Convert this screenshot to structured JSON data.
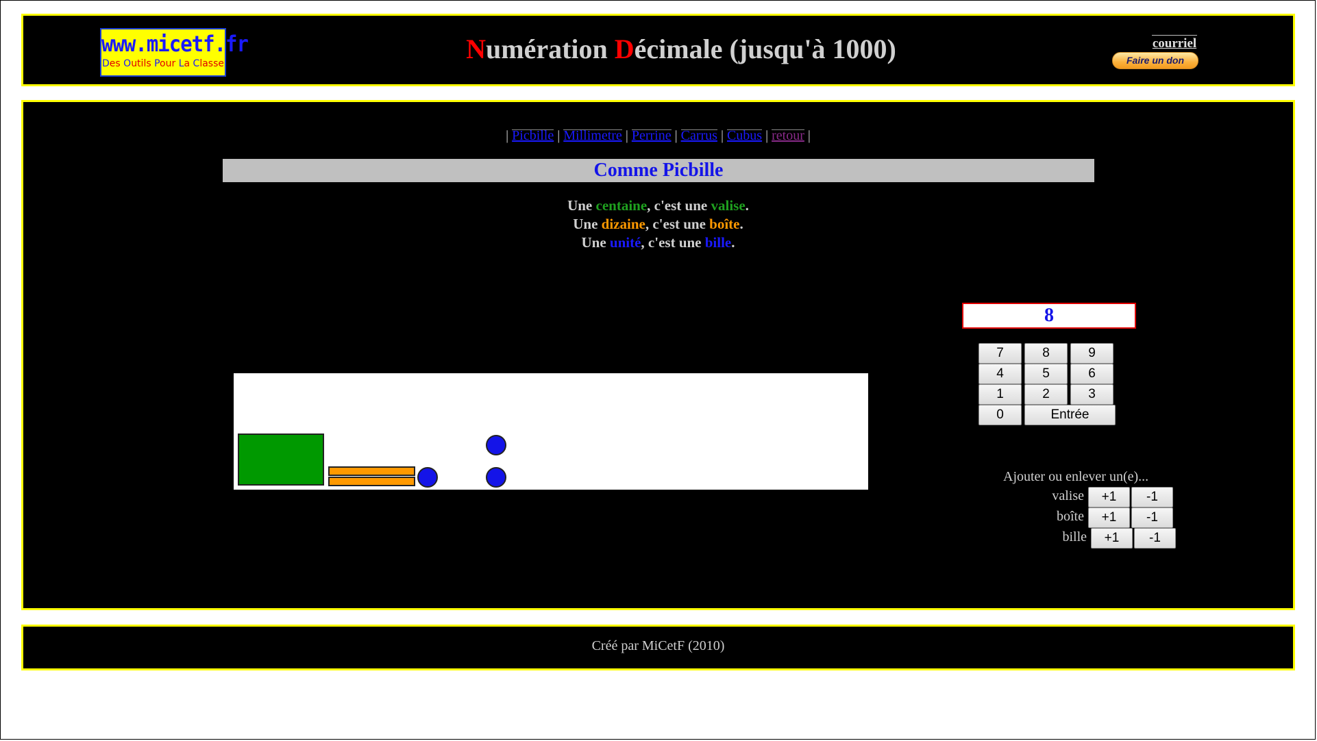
{
  "header": {
    "logo": {
      "main": "www.micetf.fr",
      "sub": "Des Outils Pour La Classe"
    },
    "title": {
      "first_letter": "N",
      "first_rest": "umération ",
      "second_letter": "D",
      "second_rest": "écimale (jusqu'à 1000)"
    },
    "courriel": "courriel",
    "donate_label": "Faire un don"
  },
  "nav": {
    "separator": "|",
    "links": [
      {
        "label": "Picbille",
        "visited": false
      },
      {
        "label": "Millimetre",
        "visited": false
      },
      {
        "label": "Perrine",
        "visited": false
      },
      {
        "label": "Carrus",
        "visited": false
      },
      {
        "label": "Cubus",
        "visited": false
      },
      {
        "label": "retour",
        "visited": true
      }
    ]
  },
  "section_title": "Comme Picbille",
  "explanations": [
    {
      "prefix": "Une ",
      "unit": "centaine",
      "middle": ", c'est une ",
      "object": "valise",
      "suffix": ".",
      "color": "#1fa01f"
    },
    {
      "prefix": "Une ",
      "unit": "dizaine",
      "middle": ", c'est une ",
      "object": "boîte",
      "suffix": ".",
      "color": "#ff9900"
    },
    {
      "prefix": "Une ",
      "unit": "unité",
      "middle": ", c'est une ",
      "object": "bille",
      "suffix": ".",
      "color": "#1a1aff"
    }
  ],
  "display_value": "8",
  "keypad": {
    "keys": [
      "7",
      "8",
      "9",
      "4",
      "5",
      "6",
      "1",
      "2",
      "3",
      "0"
    ],
    "enter": "Entrée"
  },
  "representation": {
    "valises": 1,
    "boites": 2,
    "billes": 3,
    "colors": {
      "valise": "#009900",
      "boite": "#ff9900",
      "bille": "#1414e8"
    }
  },
  "adjust": {
    "title": "Ajouter ou enlever un(e)...",
    "rows": [
      {
        "label": "valise",
        "plus": "+1",
        "minus": "-1"
      },
      {
        "label": "boîte",
        "plus": "+1",
        "minus": "-1"
      },
      {
        "label": "bille",
        "plus": "+1",
        "minus": "-1"
      }
    ]
  },
  "footer": "Créé par MiCetF (2010)"
}
